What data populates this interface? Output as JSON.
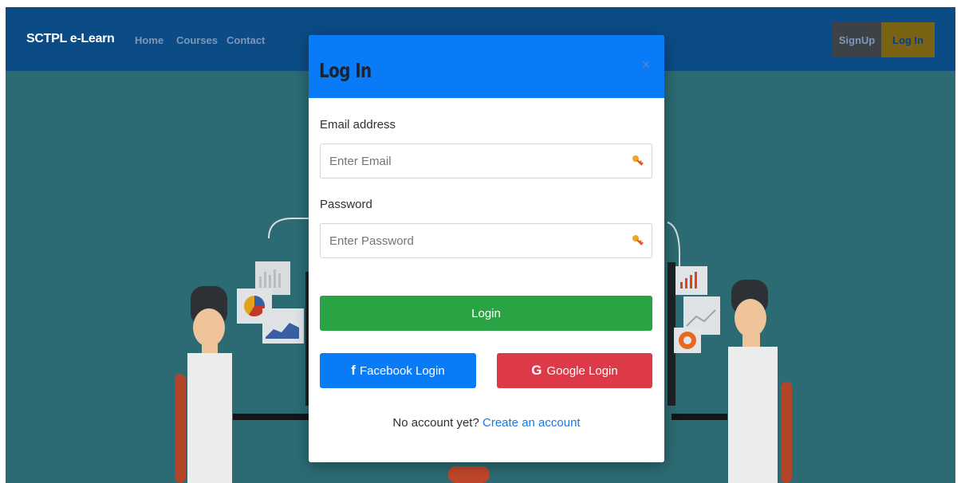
{
  "navbar": {
    "brand": "SCTPL e-Learn",
    "links": [
      "Home",
      "Courses",
      "Contact"
    ],
    "signup_label": "SignUp",
    "login_label": "Log In"
  },
  "modal": {
    "title": "Log In",
    "close_glyph": "×",
    "email_label": "Email address",
    "email_placeholder": "Enter Email",
    "email_value": "",
    "password_label": "Password",
    "password_placeholder": "Enter Password",
    "password_value": "",
    "login_button": "Login",
    "facebook_button": "Facebook Login",
    "google_button": "Google Login",
    "footer_text": "No account yet?",
    "footer_link": "Create an account"
  },
  "icons": {
    "field_icon": "key-icon",
    "facebook": "facebook-icon",
    "google": "google-icon"
  },
  "colors": {
    "navbar_bg": "#0b4c86",
    "modal_header": "#0a7bf7",
    "login_green": "#2aa345",
    "facebook_blue": "#0a7bf7",
    "google_red": "#dd3a47",
    "hero_bg": "#2c6b73"
  }
}
